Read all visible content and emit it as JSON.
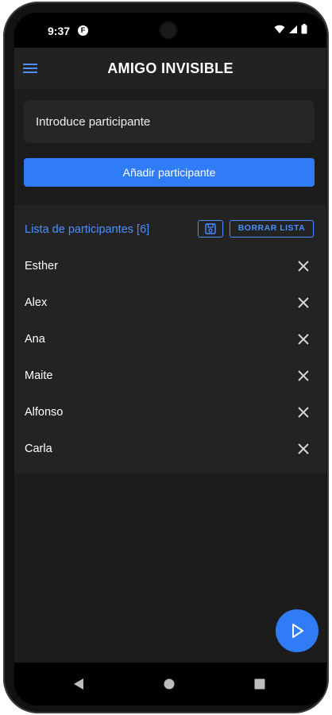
{
  "status_bar": {
    "time": "9:37",
    "app_icon_letter": "F"
  },
  "app_bar": {
    "title": "AMIGO INVISIBLE",
    "menu_icon": "hamburger-menu-icon"
  },
  "input": {
    "placeholder": "Introduce participante",
    "value": ""
  },
  "add_button": {
    "label": "Añadir participante"
  },
  "list": {
    "header": "Lista de participantes [6]",
    "save_icon": "save-icon",
    "clear_label": "BORRAR LISTA",
    "participants": [
      {
        "name": "Esther"
      },
      {
        "name": "Alex"
      },
      {
        "name": "Ana"
      },
      {
        "name": "Maite"
      },
      {
        "name": "Alfonso"
      },
      {
        "name": "Carla"
      }
    ]
  },
  "fab": {
    "icon": "play-icon"
  },
  "colors": {
    "accent": "#2f7cf6",
    "accent_text": "#4a90ff",
    "background": "#1c1c1c",
    "card": "#232323",
    "app_bar": "#222222"
  }
}
